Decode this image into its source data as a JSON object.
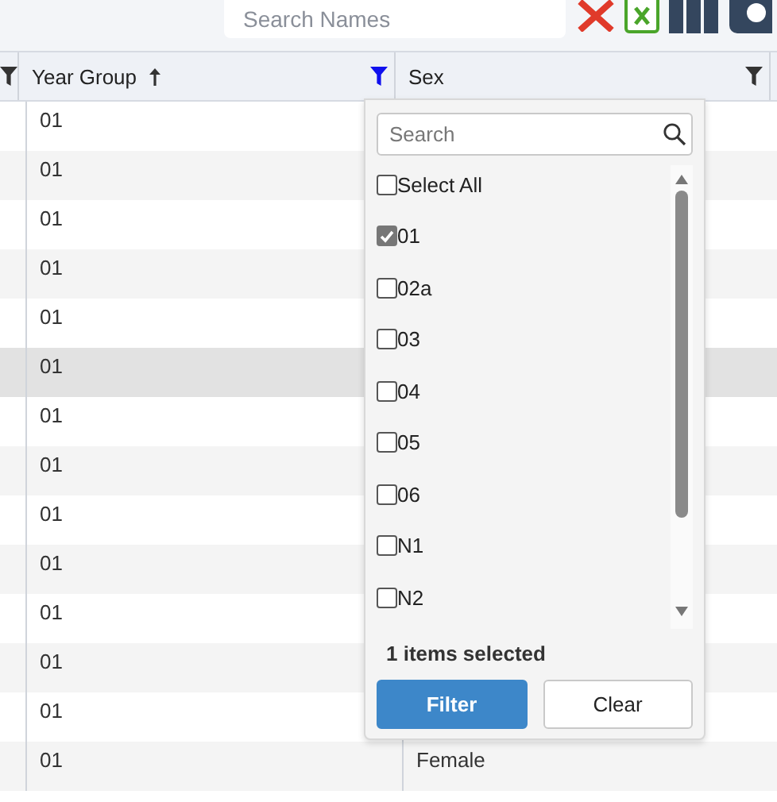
{
  "toolbar": {
    "search": {
      "placeholder": "Search Names"
    }
  },
  "columns": [
    {
      "filter_active": false
    },
    {
      "label": "Year Group",
      "sorted": true,
      "filter_active": true
    },
    {
      "label": "Sex",
      "sorted": false,
      "filter_active": false
    }
  ],
  "rows": [
    {
      "year_group": "01",
      "hovered": false
    },
    {
      "year_group": "01",
      "hovered": false
    },
    {
      "year_group": "01",
      "hovered": false
    },
    {
      "year_group": "01",
      "hovered": false
    },
    {
      "year_group": "01",
      "hovered": false
    },
    {
      "year_group": "01",
      "hovered": true
    },
    {
      "year_group": "01",
      "hovered": false
    },
    {
      "year_group": "01",
      "hovered": false
    },
    {
      "year_group": "01",
      "hovered": false
    },
    {
      "year_group": "01",
      "hovered": false
    },
    {
      "year_group": "01",
      "hovered": false
    },
    {
      "year_group": "01",
      "hovered": false
    },
    {
      "year_group": "01",
      "hovered": false
    },
    {
      "year_group": "01",
      "sex": "Female",
      "hovered": false
    }
  ],
  "filter_popup": {
    "search": {
      "placeholder": "Search"
    },
    "options": [
      {
        "label": "Select All",
        "checked": false
      },
      {
        "label": "01",
        "checked": true
      },
      {
        "label": "02a",
        "checked": false
      },
      {
        "label": "03",
        "checked": false
      },
      {
        "label": "04",
        "checked": false
      },
      {
        "label": "05",
        "checked": false
      },
      {
        "label": "06",
        "checked": false
      },
      {
        "label": "N1",
        "checked": false
      },
      {
        "label": "N2",
        "checked": false
      }
    ],
    "status": "1 items selected",
    "buttons": [
      {
        "label": "Filter",
        "kind": "primary"
      },
      {
        "label": "Clear",
        "kind": "secondary"
      }
    ]
  }
}
